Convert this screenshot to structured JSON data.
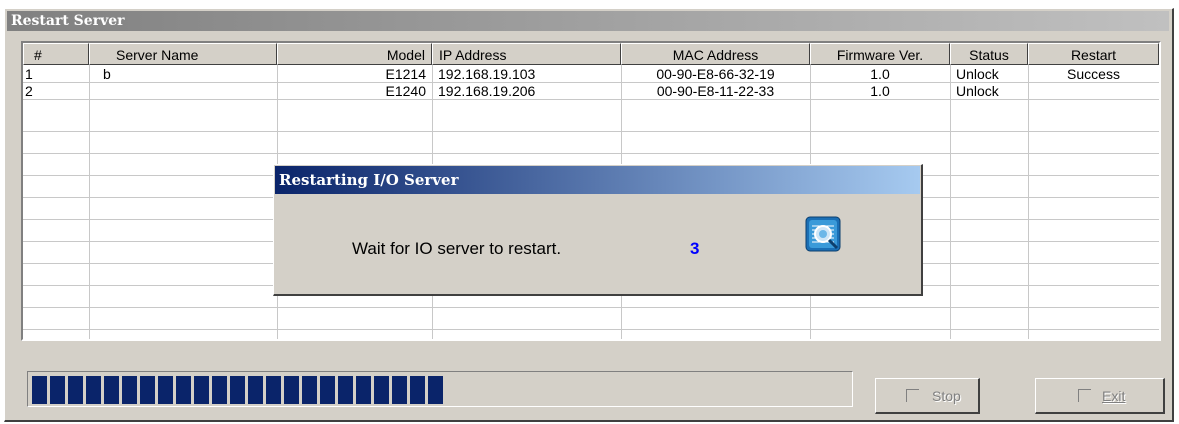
{
  "window": {
    "title": "Restart Server"
  },
  "table": {
    "headers": [
      "#",
      "Server Name",
      "Model",
      "IP Address",
      "MAC Address",
      "Firmware Ver.",
      "Status",
      "Restart"
    ],
    "rows": [
      [
        "1",
        "b",
        "E1214",
        "192.168.19.103",
        "00-90-E8-66-32-19",
        "1.0",
        "Unlock",
        "Success"
      ],
      [
        "2",
        "",
        "E1240",
        "192.168.19.206",
        "00-90-E8-11-22-33",
        "1.0",
        "Unlock",
        ""
      ]
    ]
  },
  "dialog": {
    "title": "Restarting I/O Server",
    "message": "Wait for IO server to restart.",
    "countdown": "3",
    "icon": "server-search-icon"
  },
  "progress": {
    "value_percent": 51,
    "color": "#0a246a"
  },
  "buttons": {
    "stop_label": "Stop",
    "exit_label": "Exit"
  }
}
